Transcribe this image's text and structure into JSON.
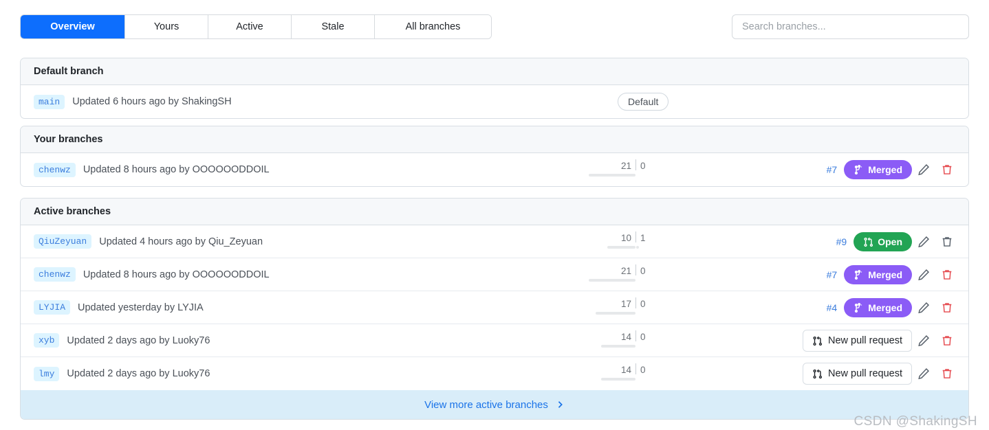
{
  "tabs": [
    {
      "label": "Overview",
      "active": true
    },
    {
      "label": "Yours",
      "active": false
    },
    {
      "label": "Active",
      "active": false
    },
    {
      "label": "Stale",
      "active": false
    },
    {
      "label": "All branches",
      "active": false
    }
  ],
  "search": {
    "placeholder": "Search branches...",
    "value": ""
  },
  "sections": {
    "default_branch": {
      "title": "Default branch",
      "row": {
        "branch": "main",
        "meta": "Updated 6 hours ago by ShakingSH",
        "default_badge": "Default"
      }
    },
    "your_branches": {
      "title": "Your branches",
      "rows": [
        {
          "branch": "chenwz",
          "meta": "Updated 8 hours ago by OOOOOODDOIL",
          "ahead": "21",
          "behind": "0",
          "pr_number": "#7",
          "status": "Merged",
          "status_kind": "merged",
          "edit_icon": "pencil-icon",
          "delete_icon": "trash-icon",
          "delete_color": "#e5484d"
        }
      ]
    },
    "active_branches": {
      "title": "Active branches",
      "rows": [
        {
          "branch": "QiuZeyuan",
          "meta": "Updated 4 hours ago by Qiu_Zeyuan",
          "ahead": "10",
          "behind": "1",
          "pr_number": "#9",
          "status": "Open",
          "status_kind": "open",
          "edit_icon": "pencil-icon",
          "delete_icon": "trash-icon",
          "delete_color": "#57606a"
        },
        {
          "branch": "chenwz",
          "meta": "Updated 8 hours ago by OOOOOODDOIL",
          "ahead": "21",
          "behind": "0",
          "pr_number": "#7",
          "status": "Merged",
          "status_kind": "merged",
          "edit_icon": "pencil-icon",
          "delete_icon": "trash-icon",
          "delete_color": "#e5484d"
        },
        {
          "branch": "LYJIA",
          "meta": "Updated yesterday by LYJIA",
          "ahead": "17",
          "behind": "0",
          "pr_number": "#4",
          "status": "Merged",
          "status_kind": "merged",
          "edit_icon": "pencil-icon",
          "delete_icon": "trash-icon",
          "delete_color": "#e5484d"
        },
        {
          "branch": "xyb",
          "meta": "Updated 2 days ago by Luoky76",
          "ahead": "14",
          "behind": "0",
          "pr_number": "",
          "status": "New pull request",
          "status_kind": "new_pr",
          "edit_icon": "pencil-icon",
          "delete_icon": "trash-icon",
          "delete_color": "#e5484d"
        },
        {
          "branch": "lmy",
          "meta": "Updated 2 days ago by Luoky76",
          "ahead": "14",
          "behind": "0",
          "pr_number": "",
          "status": "New pull request",
          "status_kind": "new_pr",
          "edit_icon": "pencil-icon",
          "delete_icon": "trash-icon",
          "delete_color": "#e5484d"
        }
      ],
      "footer": {
        "label": "View more active branches",
        "chevron": "chevron-right-icon"
      }
    }
  },
  "watermark": "CSDN @ShakingSH",
  "colors": {
    "accent_blue": "#0d6efd",
    "merged_purple": "#8b5cf6",
    "open_green": "#22a454",
    "chip_bg": "#ddf4ff",
    "link_blue": "#1a73e8",
    "footer_bg": "#d9edf9"
  }
}
